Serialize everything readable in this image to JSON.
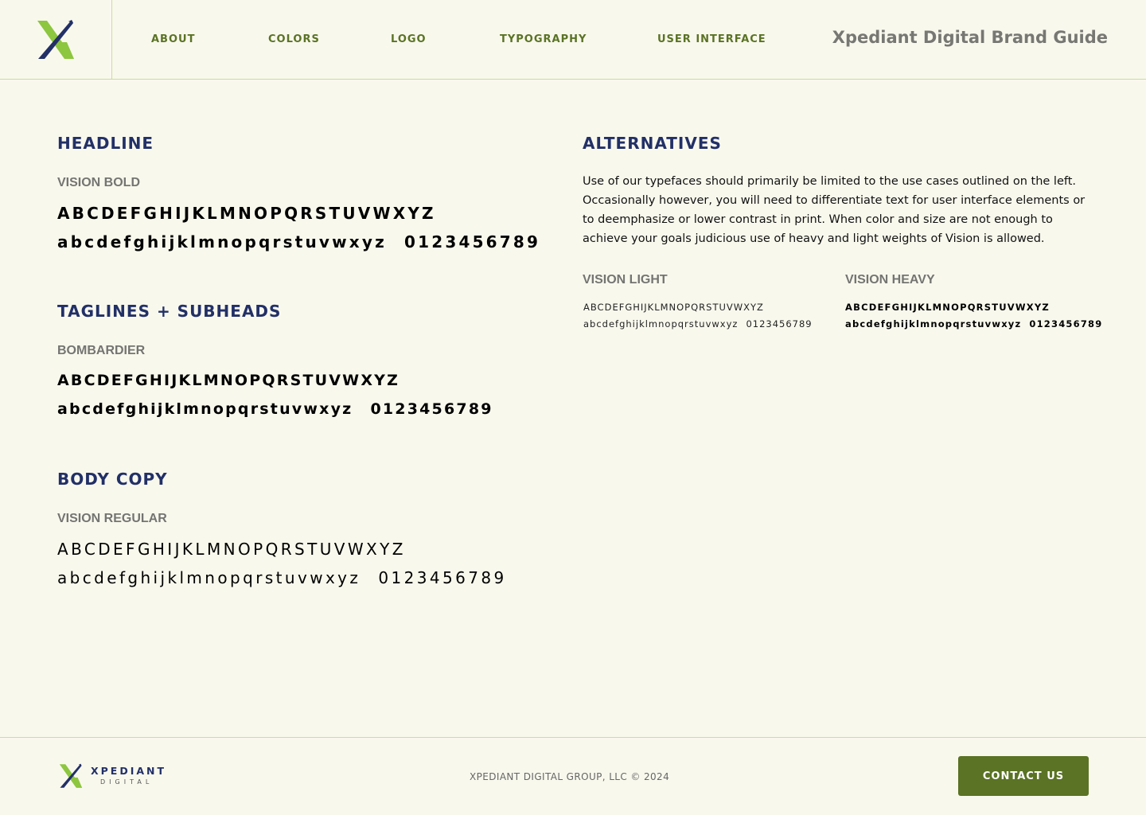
{
  "header": {
    "nav": [
      {
        "label": "ABOUT"
      },
      {
        "label": "COLORS"
      },
      {
        "label": "LOGO"
      },
      {
        "label": "TYPOGRAPHY"
      },
      {
        "label": "USER INTERFACE"
      }
    ],
    "brand_title": "Xpediant Digital Brand Guide"
  },
  "typography": {
    "headline": {
      "title": "HEADLINE",
      "font": "VISION BOLD",
      "upper": "ABCDEFGHIJKLMNOPQRSTUVWXYZ",
      "lower": "abcdefghijklmnopqrstuvwxyz",
      "digits": "0123456789"
    },
    "taglines": {
      "title": "TAGLINES + SUBHEADS",
      "font": "BOMBARDIER",
      "upper": "ABCDEFGHIJKLMNOPQRSTUVWXYZ",
      "lower": "abcdefghijklmnopqrstuvwxyz",
      "digits": "0123456789"
    },
    "body_copy": {
      "title": "BODY COPY",
      "font": "VISION REGULAR",
      "upper": "ABCDEFGHIJKLMNOPQRSTUVWXYZ",
      "lower": "abcdefghijklmnopqrstuvwxyz",
      "digits": "0123456789"
    },
    "alternatives": {
      "title": "ALTERNATIVES",
      "body": "Use of our typefaces should primarily be limited to the use cases outlined on the left. Occasionally however, you will need to differentiate text for user interface elements or to deemphasize or lower contrast in print. When color and size are not enough to achieve your goals judicious use of heavy and light weights of Vision is allowed.",
      "light": {
        "font": "VISION LIGHT",
        "upper": "ABCDEFGHIJKLMNOPQRSTUVWXYZ",
        "lower": "abcdefghijklmnopqrstuvwxyz",
        "digits": "0123456789"
      },
      "heavy": {
        "font": "VISION HEAVY",
        "upper": "ABCDEFGHIJKLMNOPQRSTUVWXYZ",
        "lower": "abcdefghijklmnopqrstuvwxyz",
        "digits": "0123456789"
      }
    }
  },
  "footer": {
    "wordmark_main": "XPEDIANT",
    "wordmark_sub": "DIGITAL",
    "copyright": "XPEDIANT DIGITAL GROUP, LLC © 2024",
    "contact_label": "CONTACT US"
  },
  "colors": {
    "navy": "#223067",
    "green": "#5a7324",
    "light_green": "#8dc63f",
    "background": "#f9f8ed"
  },
  "icons": {
    "header_logo": "xpediant-x-logo-icon",
    "footer_logo": "xpediant-x-logo-icon"
  }
}
